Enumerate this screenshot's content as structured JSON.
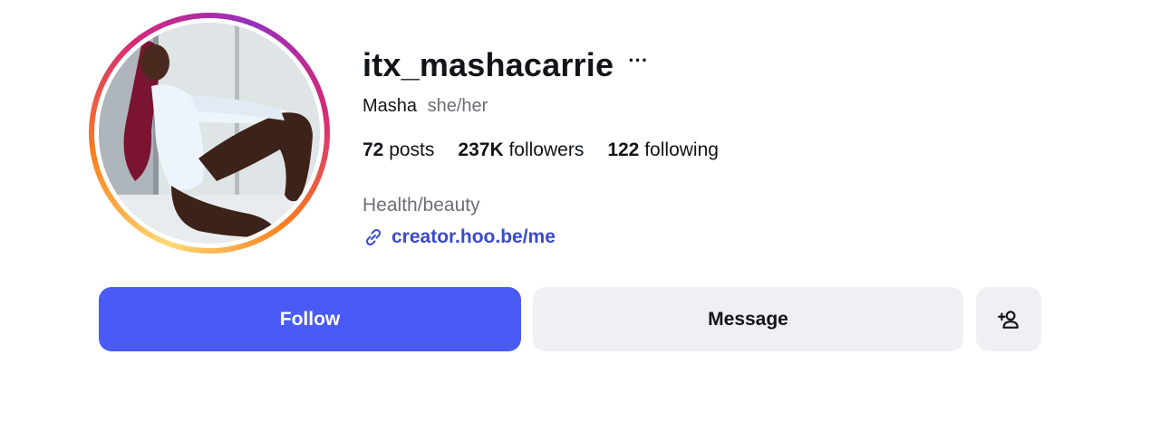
{
  "profile": {
    "username": "itx_mashacarrie",
    "more_label": "···",
    "display_name": "Masha",
    "pronouns": "she/her",
    "category": "Health/beauty",
    "link": "creator.hoo.be/me"
  },
  "stats": {
    "posts_count": "72",
    "posts_label": "posts",
    "followers_count": "237K",
    "followers_label": "followers",
    "following_count": "122",
    "following_label": "following"
  },
  "actions": {
    "follow_label": "Follow",
    "message_label": "Message",
    "add_user_icon": "add-person-icon"
  },
  "colors": {
    "follow_button": "#4a5bf5",
    "link": "#3a4ad0",
    "secondary_button": "#eff0f3",
    "muted_text": "#6b7075"
  }
}
